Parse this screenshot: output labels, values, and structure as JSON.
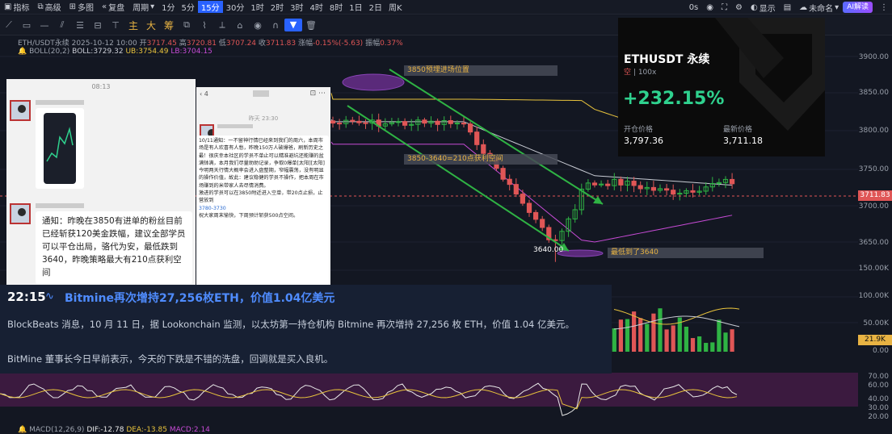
{
  "toolbar": {
    "indicators": "指标",
    "advanced": "高级",
    "multi": "多图",
    "replay": "复盘",
    "period": "周期",
    "timeframes": [
      "1分",
      "5分",
      "15分",
      "30分",
      "1时",
      "2时",
      "3时",
      "4时",
      "8时",
      "1日",
      "2日",
      "周K"
    ],
    "active_timeframe": "15分",
    "zero_s": "0s",
    "display": "显示",
    "unnamed": "未命名",
    "ai": "AI解读"
  },
  "drawing_cn": [
    "主",
    "大",
    "筹"
  ],
  "info": {
    "symbol": "ETH/USDT永续",
    "datetime": "2025-10-12 10:00",
    "open_label": "开",
    "open": "3717.45",
    "high_label": "高",
    "high": "3720.81",
    "low_label": "低",
    "low": "3707.24",
    "close_label": "收",
    "close": "3711.83",
    "change_label": "涨幅",
    "change": "-0.15%(-5.63)",
    "amp_label": "振幅",
    "amp": "0.37%"
  },
  "boll": {
    "name": "BOLL(20,2)",
    "mid": "BOLL:3729.32",
    "ub": "UB:3754.49",
    "lb": "LB:3704.15"
  },
  "y_axis": [
    "3900.00",
    "3850.00",
    "3800.00",
    "3750.00",
    "3700.00",
    "3650.00",
    "150.00K",
    "100.00K",
    "50.00K",
    "0.00",
    "70.00",
    "60.00",
    "40.00",
    "30.00",
    "20.00"
  ],
  "price_tag": "3711.83",
  "vol_tag": "21.9K",
  "annotations": {
    "a1": "3850预埋进场位置",
    "a2": "3850-3640=210点获利空间",
    "a3": "3640.00",
    "a4": "最低到了3640"
  },
  "card": {
    "title": "ETHUSDT 永续",
    "side": "空",
    "leverage": "100x",
    "pnl": "+232.15%",
    "open_label": "开仓价格",
    "open_price": "3,797.36",
    "last_label": "最新价格",
    "last_price": "3,711.18"
  },
  "phone1": {
    "time": "08:13",
    "msg": "通知：昨晚在3850有进单的粉丝目前已经斩获120美金跌幅，建议全部学员可以平仓出局，骆代为安，最低跌到3640，昨晚策略最大有210点获利空间"
  },
  "phone2": {
    "badge": "4",
    "date": "昨天 23:30",
    "msg1": "10/11通知：一不留神行情已经来到我们的周六，本周市场是有人欢喜有人愁，昨晚150万人破爆爸，刷新历史之最！很庆幸本社区的学员不单止可以精准避坑还能赚的盆满钵满，本月我们尽量助助记录，争取0爆单[太阳][太阳]",
    "msg2": "今明两天行情大概率会进入盘整期，窄幅震荡，没有明显的操作价值，故此：建议稳健的学员不操作，把本周在市场赚到的米带家人去尽情消费。",
    "msg3": "激进的学员可以在3850附近进入空单，带20点止损，止营放到",
    "msg3b": "3780-3730",
    "msg4": "祝大家周末愉快，下周预计斩获500点空间。"
  },
  "news": {
    "time": "22:15",
    "headline": "Bitmine再次增持27,256枚ETH，价值1.04亿美元",
    "p1": "BlockBeats 消息，10 月 11 日，据 Lookonchain 监测，以太坊第一持仓机构 Bitmine 再次增持 27,256 枚 ETH，价值 1.04 亿美元。",
    "p2": "BitMine 董事长今日早前表示，今天的下跌是不错的洗盘，回调就是买入良机。"
  },
  "macd": {
    "name": "MACD(12,26,9)",
    "dif": "DIF:-12.78",
    "dea": "DEA:-13.85",
    "macd": "MACD:2.14"
  }
}
